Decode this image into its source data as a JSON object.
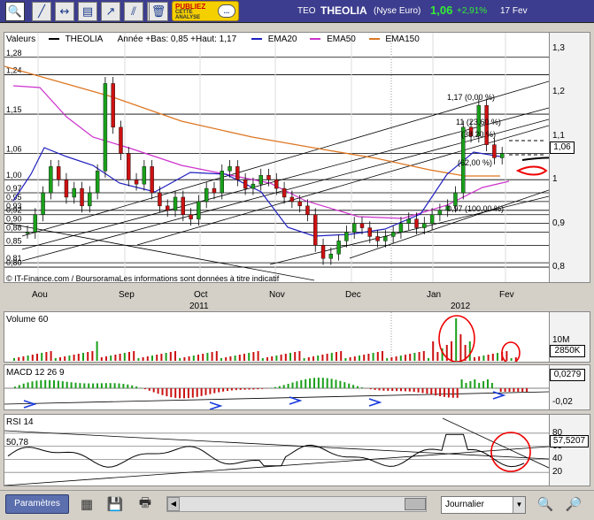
{
  "toolbar": {
    "tools": [
      {
        "name": "zoom-tool-icon",
        "glyph": "🔍"
      },
      {
        "name": "line-tool-icon",
        "glyph": "╱"
      },
      {
        "name": "horizontal-line-icon",
        "glyph": "↔"
      },
      {
        "name": "fibonacci-icon",
        "glyph": "▤"
      },
      {
        "name": "arrow-icon",
        "glyph": "↗"
      },
      {
        "name": "channel-icon",
        "glyph": "⫽"
      },
      {
        "name": "measure-icon",
        "glyph": "⇵"
      },
      {
        "name": "trash-icon",
        "glyph": "🗑"
      }
    ],
    "promo_line1": "PUBLIEZ",
    "promo_line2a": "CETTE",
    "promo_line2b": "ANALYSE",
    "promo_bubble": "..."
  },
  "quote": {
    "code": "TEO",
    "name": "THEOLIA",
    "market": "(Nyse Euro)",
    "price": "1,06",
    "change": "+2,91%",
    "date": "17 Fev"
  },
  "main_chart": {
    "legend_valeurs": "Valeurs",
    "legend_name": "THEOLIA",
    "legend_stats": "Année +Bas: 0,85 +Haut: 1,17",
    "ema20": "EMA20",
    "ema50": "EMA50",
    "ema150": "EMA150",
    "right_ticks": [
      "1,3",
      "1,2",
      "1,1",
      "1",
      "0,9",
      "0,8"
    ],
    "left_levels": [
      "1,28",
      "1,24",
      "1,15",
      "1,06",
      "1,00",
      "0,97",
      "0,95",
      "0,93",
      "0,92",
      "0,90",
      "0,88",
      "0,85",
      "0,81",
      "0,80"
    ],
    "fib_labels": [
      "1,17 (0,00 %)",
      "11 (23,60 %)",
      "(38,20 %)",
      "(62,00 %)",
      "0,97 (100,00 %)"
    ],
    "price_box": "1,06",
    "copyright": "© IT-Finance.com / BoursoramaLes informations sont données à titre indicatif",
    "colors": {
      "ema20": "#2020c0",
      "ema50": "#cc33cc",
      "ema150": "#dd7722"
    }
  },
  "x_axis": {
    "months": [
      "Aou",
      "Sep",
      "Oct",
      "Nov",
      "Dec",
      "Jan",
      "Fev"
    ],
    "years": [
      "2011",
      "2012"
    ]
  },
  "volume_panel": {
    "label": "Volume 60",
    "tick": "10M",
    "value_box": "2850K"
  },
  "macd_panel": {
    "label": "MACD 12 26 9",
    "value_box": "0,0279",
    "tick": "-0,02"
  },
  "rsi_panel": {
    "label": "RSI 14",
    "left_value": "50,78",
    "ticks": [
      "80",
      "60",
      "40",
      "20"
    ],
    "value_box": "57,5207"
  },
  "bottom_bar": {
    "params_label": "Paramètres",
    "period_value": "Journalier"
  },
  "chart_data": [
    {
      "type": "candlestick",
      "title": "THEOLIA",
      "ylim": [
        0.79,
        1.32
      ],
      "x_categories": [
        "Aou",
        "Sep",
        "Oct",
        "Nov",
        "Dec",
        "Jan",
        "Fev"
      ],
      "close_series_approx": [
        0.88,
        0.92,
        0.97,
        1.03,
        1.0,
        0.96,
        0.98,
        0.94,
        0.97,
        1.02,
        1.22,
        1.12,
        1.06,
        1.0,
        0.99,
        1.03,
        0.97,
        0.94,
        0.93,
        0.96,
        0.92,
        0.91,
        0.95,
        0.98,
        0.97,
        1.02,
        1.03,
        1.0,
        0.98,
        0.99,
        1.01,
        1.0,
        0.98,
        0.96,
        0.95,
        0.94,
        0.92,
        0.85,
        0.82,
        0.83,
        0.86,
        0.88,
        0.9,
        0.89,
        0.87,
        0.86,
        0.87,
        0.88,
        0.9,
        0.91,
        0.89,
        0.9,
        0.92,
        0.93,
        0.94,
        0.97,
        1.12,
        1.1,
        1.17,
        1.08,
        1.05,
        1.06
      ]
    },
    {
      "type": "bar",
      "title": "Volume 60",
      "note": "volume spike in January 2012"
    }
  ]
}
